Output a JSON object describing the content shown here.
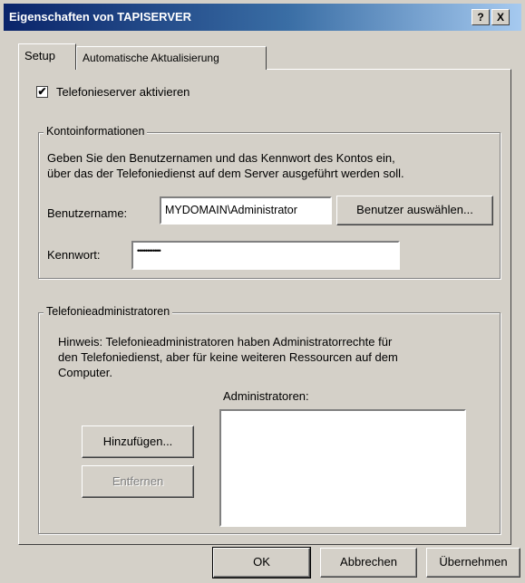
{
  "window": {
    "title": "Eigenschaften von TAPISERVER",
    "help_label": "?",
    "close_label": "X"
  },
  "tabs": [
    {
      "label": "Setup",
      "active": true
    },
    {
      "label": "Automatische Aktualisierung",
      "active": false
    }
  ],
  "checkbox": {
    "label": "Telefonieserver aktivieren",
    "checked": true,
    "mark": "✔"
  },
  "account": {
    "legend": "Kontoinformationen",
    "description_line1": "Geben Sie den Benutzernamen und das Kennwort des Kontos ein,",
    "description_line2": "über das der Telefoniedienst auf dem Server ausgeführt werden soll.",
    "username_label": "Benutzername:",
    "username_value": "MYDOMAIN\\Administrator",
    "select_user_button": "Benutzer auswählen...",
    "password_label": "Kennwort:",
    "password_value": "••••••••••••"
  },
  "admins": {
    "legend": "Telefonieadministratoren",
    "hint_line1": "Hinweis: Telefonieadministratoren haben Administratorrechte für",
    "hint_line2": "den Telefoniedienst, aber für keine weiteren Ressourcen auf dem",
    "hint_line3": "Computer.",
    "list_label": "Administratoren:",
    "add_button": "Hinzufügen...",
    "remove_button": "Entfernen",
    "items": []
  },
  "footer": {
    "ok": "OK",
    "cancel": "Abbrechen",
    "apply": "Übernehmen"
  }
}
